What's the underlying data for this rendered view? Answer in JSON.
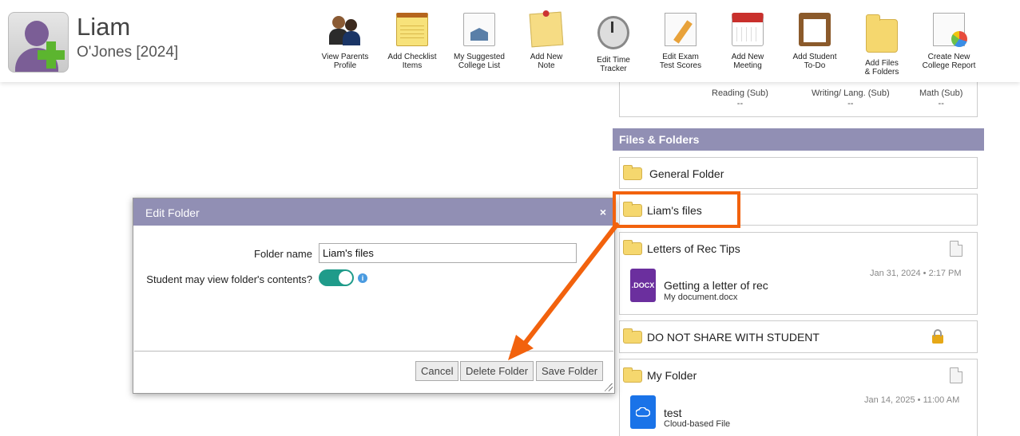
{
  "student": {
    "first_name": "Liam",
    "last_name_year": "O'Jones [2024]"
  },
  "toolbar": [
    {
      "label": "View Parents\nProfile",
      "icon": "parents-icon"
    },
    {
      "label": "Add Checklist\nItems",
      "icon": "notepad-icon"
    },
    {
      "label": "My Suggested\nCollege List",
      "icon": "college-list-icon"
    },
    {
      "label": "Add New\nNote",
      "icon": "note-icon"
    },
    {
      "label": "Edit Time\nTracker",
      "icon": "stopwatch-icon"
    },
    {
      "label": "Edit Exam\nTest Scores",
      "icon": "exam-icon"
    },
    {
      "label": "Add New\nMeeting",
      "icon": "calendar-icon"
    },
    {
      "label": "Add Student\nTo-Do",
      "icon": "clipboard-icon"
    },
    {
      "label": "Add Files\n& Folders",
      "icon": "folder-icon"
    },
    {
      "label": "Create New\nCollege Report",
      "icon": "report-icon"
    }
  ],
  "scores": [
    {
      "label": "Reading (Sub)",
      "value": "--"
    },
    {
      "label": "Writing/ Lang. (Sub)",
      "value": "--"
    },
    {
      "label": "Math (Sub)",
      "value": "--"
    }
  ],
  "files_section": {
    "title": "Files & Folders",
    "folders": {
      "general": "General Folder",
      "liams": "Liam's files",
      "letters": "Letters of Rec Tips",
      "donotshare": "DO NOT SHARE WITH STUDENT",
      "myfolder": "My Folder"
    },
    "files": {
      "letters_file": {
        "name": "Getting a letter of rec",
        "sub": "My document.docx",
        "date": "Jan 31, 2024 • 2:17 PM",
        "badge": ".DOCX"
      },
      "myfolder_file": {
        "name": "test",
        "sub": "Cloud-based File",
        "date": "Jan 14, 2025 • 11:00 AM"
      }
    }
  },
  "modal": {
    "title": "Edit Folder",
    "close": "×",
    "folder_name_label": "Folder name",
    "folder_name_value": "Liam's files",
    "student_view_label": "Student may view folder's contents?",
    "student_view_enabled": true,
    "info": "i",
    "buttons": {
      "cancel": "Cancel",
      "delete": "Delete Folder",
      "save": "Save Folder"
    }
  },
  "colors": {
    "header_bar": "#918fb4",
    "toggle_on": "#1f9b8a",
    "annotation": "#f2620d",
    "docx": "#6b2f9e",
    "cloud": "#1a73e8"
  }
}
